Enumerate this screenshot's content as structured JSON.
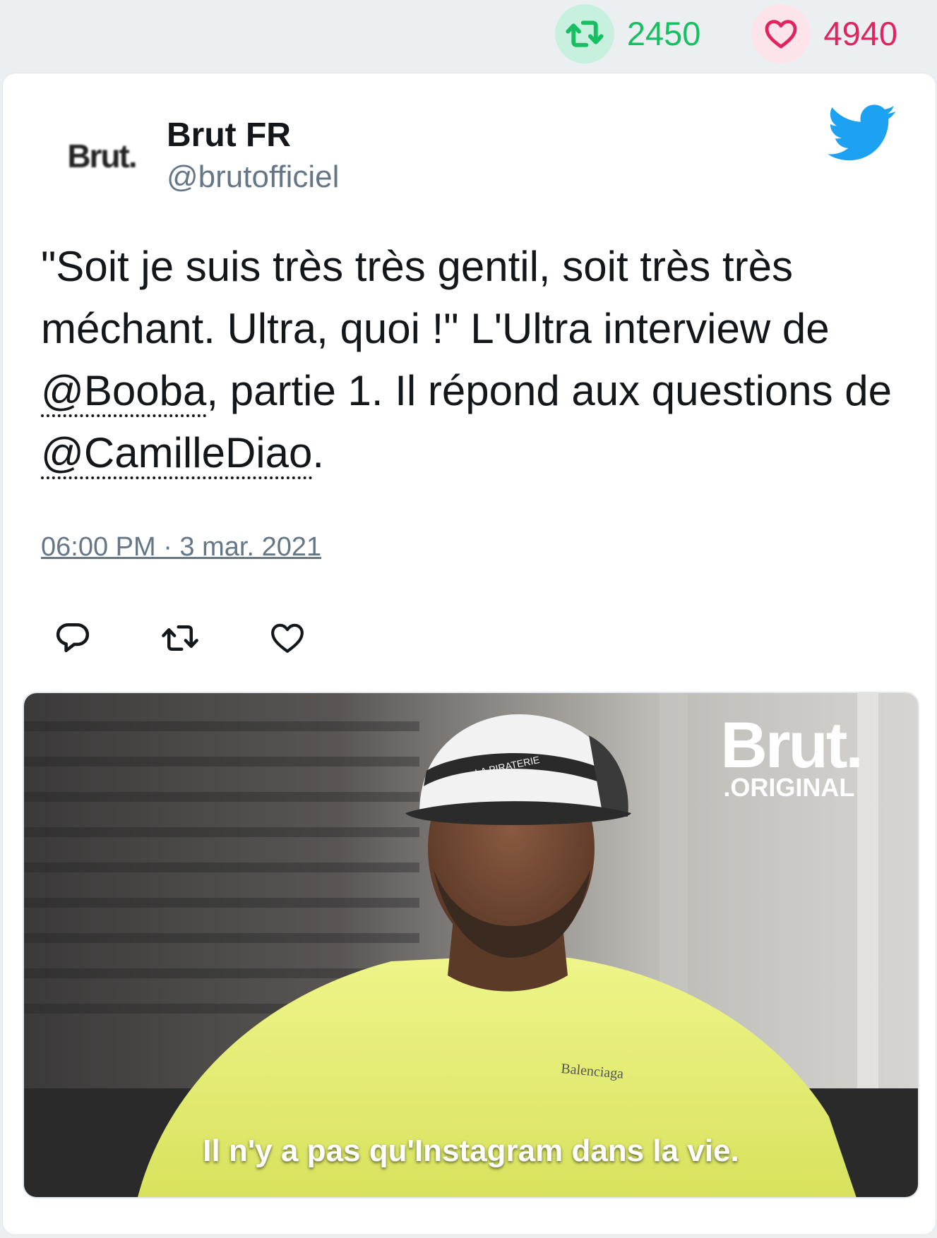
{
  "stats": {
    "retweet_count": "2450",
    "like_count": "4940",
    "retweet_icon": "retweet-icon",
    "like_icon": "heart-icon"
  },
  "tweet": {
    "author_name": "Brut FR",
    "author_handle": "@brutofficiel",
    "avatar_text": "Brut.",
    "text_part1": "\"Soit je suis très très gentil, soit très très méchant. Ultra, quoi !\" L'Ultra interview de ",
    "mention1": "@Booba",
    "text_part2": ", partie 1. Il répond aux questions de ",
    "mention2": "@CamilleDiao",
    "text_part3": ".",
    "timestamp": "06:00 PM · 3 mar. 2021"
  },
  "actions": [
    "reply-icon",
    "retweet-icon",
    "heart-icon"
  ],
  "media": {
    "brand_word": "Brut.",
    "brand_sub": ".ORIGINAL",
    "cap_text": "LA PIRATERIE",
    "shirt_text": "Balenciaga",
    "subtitle": "Il n'y a pas qu'Instagram dans la vie."
  },
  "colors": {
    "retweet_green": "#17bf63",
    "like_pink": "#e0245e",
    "twitter_blue": "#1da1f2",
    "handle_gray": "#657786"
  }
}
